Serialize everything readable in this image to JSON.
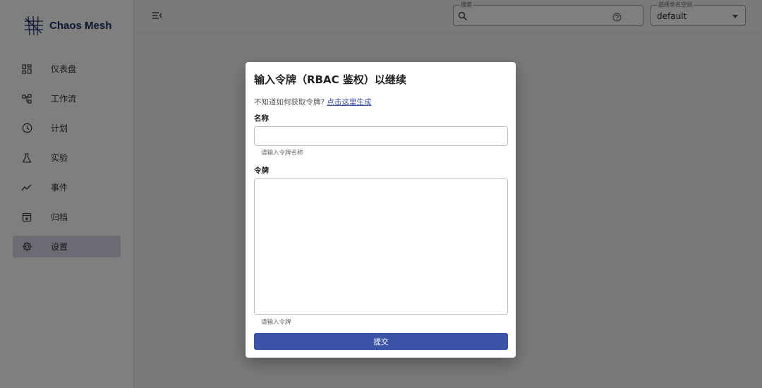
{
  "app": {
    "name": "Chaos Mesh"
  },
  "sidebar": {
    "items": [
      {
        "label": "仪表盘",
        "icon": "dashboard-icon"
      },
      {
        "label": "工作流",
        "icon": "workflow-icon"
      },
      {
        "label": "计划",
        "icon": "clock-icon"
      },
      {
        "label": "实验",
        "icon": "flask-icon"
      },
      {
        "label": "事件",
        "icon": "chart-line-icon"
      },
      {
        "label": "归档",
        "icon": "archive-icon"
      },
      {
        "label": "设置",
        "icon": "gear-icon",
        "active": true
      }
    ]
  },
  "header": {
    "search": {
      "legend": "搜索",
      "value": ""
    },
    "namespace": {
      "legend": "选择命名空间",
      "value": "default"
    }
  },
  "dialog": {
    "title": "输入令牌（RBAC 鉴权）以继续",
    "hint_text": "不知道如何获取令牌?",
    "hint_link": "点击这里生成",
    "name_label": "名称",
    "name_value": "",
    "name_helper": "请输入令牌名称",
    "token_label": "令牌",
    "token_value": "",
    "token_helper": "请输入令牌",
    "submit_label": "提交"
  },
  "colors": {
    "primary": "#3c54a8",
    "brand": "#1b2a66",
    "active_nav": "#d4d6e6"
  }
}
